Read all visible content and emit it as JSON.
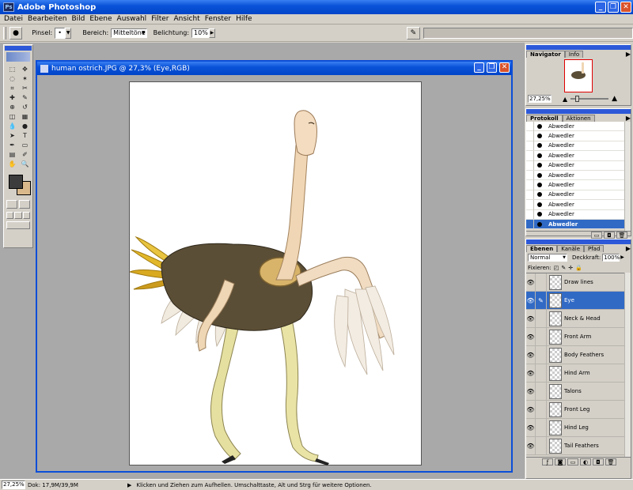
{
  "app": {
    "title": "Adobe Photoshop"
  },
  "menu": [
    "Datei",
    "Bearbeiten",
    "Bild",
    "Ebene",
    "Auswahl",
    "Filter",
    "Ansicht",
    "Fenster",
    "Hilfe"
  ],
  "options": {
    "brush_label": "Pinsel:",
    "brush_size": "•",
    "range_label": "Bereich:",
    "range_value": "Mitteltöne",
    "exposure_label": "Belichtung:",
    "exposure_value": "10%"
  },
  "document": {
    "title": "human ostrich.JPG @ 27,3% (Eye,RGB)"
  },
  "navigator": {
    "tabs": [
      "Navigator",
      "Info"
    ],
    "zoom": "27,25%"
  },
  "history": {
    "tabs": [
      "Protokoll",
      "Aktionen"
    ],
    "items": [
      "Abwedler",
      "Abwedler",
      "Abwedler",
      "Abwedler",
      "Abwedler",
      "Abwedler",
      "Abwedler",
      "Abwedler",
      "Abwedler",
      "Abwedler",
      "Abwedler"
    ],
    "selected_index": 10
  },
  "layers": {
    "tabs": [
      "Ebenen",
      "Kanäle",
      "Pfad"
    ],
    "blend_mode": "Normal",
    "opacity_label": "Deckkraft:",
    "opacity_value": "100%",
    "lock_label": "Fixieren:",
    "items": [
      "Draw lines",
      "Eye",
      "Neck & Head",
      "Front Arm",
      "Body Feathers",
      "Hind Arm",
      "Talons",
      "Front Leg",
      "Hind Leg",
      "Tail Feathers"
    ],
    "selected_index": 1
  },
  "status": {
    "zoom": "27,25%",
    "doc": "Dok: 17,9M/39,9M",
    "hint": "Klicken und Ziehen zum Aufhellen. Umschalttaste, Alt und Strg für weitere Optionen."
  },
  "colors": {
    "foreground": "#3c3c3c",
    "background": "#d9b98c",
    "accent": "#316ac5",
    "title": "#0a53d8"
  }
}
